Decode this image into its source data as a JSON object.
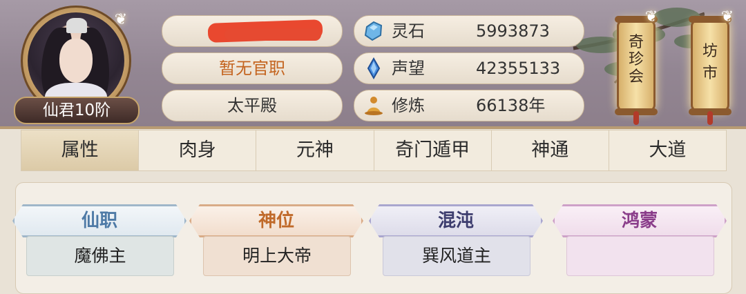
{
  "profile": {
    "rank_badge": "仙君10阶",
    "official_post": "暂无官职",
    "palace": "太平殿"
  },
  "resources": [
    {
      "label": "灵石",
      "value": "5993873",
      "icon": "spirit-stone-icon"
    },
    {
      "label": "声望",
      "value": "42355133",
      "icon": "prestige-crystal-icon"
    },
    {
      "label": "修炼",
      "value": "66138年",
      "icon": "meditation-icon"
    }
  ],
  "lanterns": [
    {
      "text": "奇珍会"
    },
    {
      "text": "坊市"
    }
  ],
  "tabs": [
    "属性",
    "肉身",
    "元神",
    "奇门遁甲",
    "神通",
    "大道"
  ],
  "active_tab": "属性",
  "ranks": [
    {
      "title": "仙职",
      "value": "魔佛主",
      "color": "#4e7aa6"
    },
    {
      "title": "神位",
      "value": "明上大帝",
      "color": "#c06a2a"
    },
    {
      "title": "混沌",
      "value": "巽风道主",
      "color": "#4a4a7a"
    },
    {
      "title": "鸿蒙",
      "value": "",
      "color": "#8a3d8a"
    }
  ],
  "colors": {
    "official_post_text": "#c4641f",
    "header_bg": "#998c98"
  }
}
